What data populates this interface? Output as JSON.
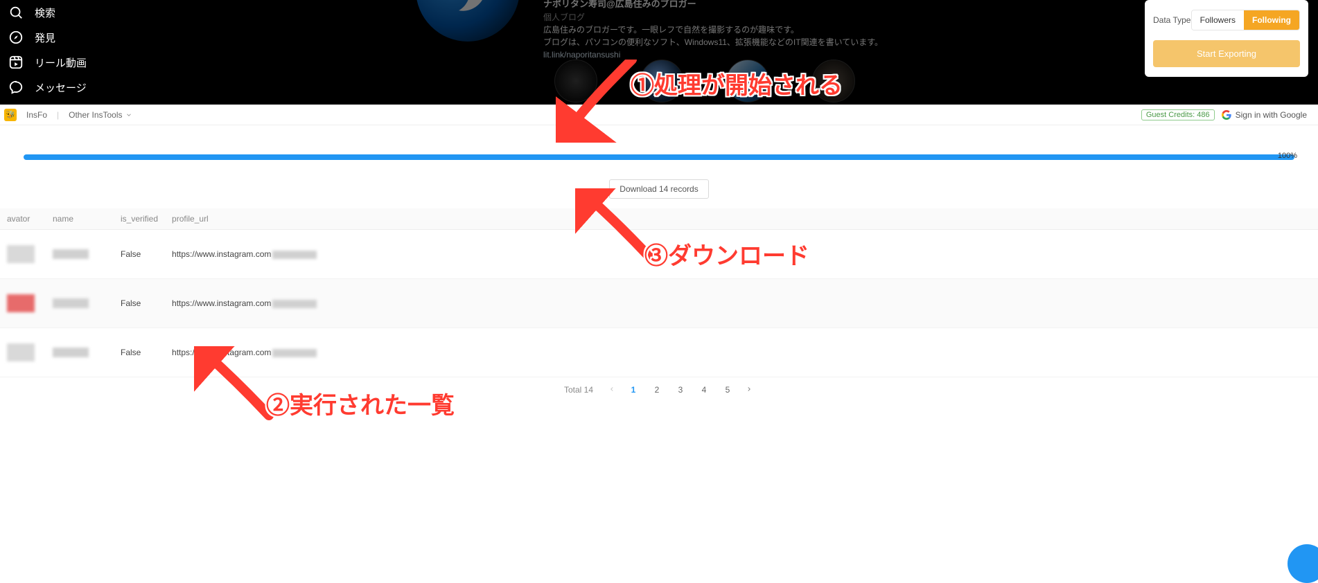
{
  "sidebar": {
    "items": [
      {
        "label": "検索",
        "icon": "search"
      },
      {
        "label": "発見",
        "icon": "compass"
      },
      {
        "label": "リール動画",
        "icon": "reels"
      },
      {
        "label": "メッセージ",
        "icon": "messenger"
      }
    ]
  },
  "profile": {
    "title_line": "ナポリタン寿司@広島住みのブロガー",
    "category": "個人ブログ",
    "bio_line1": "広島住みのブロガーです。一眼レフで自然を撮影するのが趣味です。",
    "bio_line2": "ブログは、パソコンの便利なソフト、Windows11、拡張機能などのIT関連を書いています。",
    "link": "lit.link/naporitansushi"
  },
  "export_panel": {
    "label": "Data Type",
    "opt_followers": "Followers",
    "opt_following": "Following",
    "btn_export": "Start Exporting"
  },
  "toolbar": {
    "brand": "InsFo",
    "other": "Other InsTools",
    "credits": "Guest Credits: 486",
    "signin": "Sign in with Google"
  },
  "progress": {
    "percent": "100%"
  },
  "download": {
    "label": "Download 14 records"
  },
  "table": {
    "headers": {
      "avator": "avator",
      "name": "name",
      "is_verified": "is_verified",
      "profile_url": "profile_url"
    },
    "rows": [
      {
        "is_verified": "False",
        "profile_url_prefix": "https://www.instagram.com"
      },
      {
        "is_verified": "False",
        "profile_url_prefix": "https://www.instagram.com"
      },
      {
        "is_verified": "False",
        "profile_url_prefix": "https://www.instagram.com"
      }
    ]
  },
  "pagination": {
    "total_label": "Total 14",
    "pages": [
      "1",
      "2",
      "3",
      "4",
      "5"
    ]
  },
  "annotations": {
    "a1": "①処理が開始される",
    "a2": "②実行された一覧",
    "a3": "③ダウンロード"
  }
}
